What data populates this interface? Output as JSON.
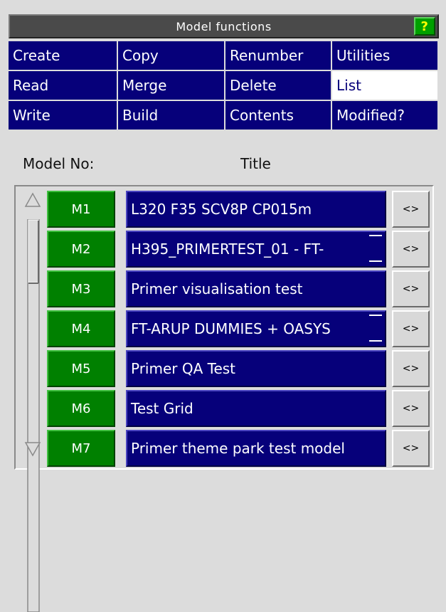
{
  "panel": {
    "title": "Model functions",
    "help_label": "?"
  },
  "menu": [
    [
      "Create",
      "Copy",
      "Renumber",
      "Utilities"
    ],
    [
      "Read",
      "Merge",
      "Delete",
      "List"
    ],
    [
      "Write",
      "Build",
      "Contents",
      "Modified?"
    ]
  ],
  "menu_selected": "List",
  "headers": {
    "model_no": "Model No:",
    "title": "Title"
  },
  "models": [
    {
      "id": "M1",
      "title": "L320 F35 SCV8P CP015m",
      "truncated": false
    },
    {
      "id": "M2",
      "title": "H395_PRIMERTEST_01 - FT-",
      "truncated": true
    },
    {
      "id": "M3",
      "title": "Primer visualisation test",
      "truncated": false
    },
    {
      "id": "M4",
      "title": "FT-ARUP DUMMIES + OASYS",
      "truncated": true
    },
    {
      "id": "M5",
      "title": "Primer QA Test",
      "truncated": false
    },
    {
      "id": "M6",
      "title": "Test Grid",
      "truncated": false
    },
    {
      "id": "M7",
      "title": "Primer theme park test model",
      "truncated": false
    }
  ],
  "row_button_label": "<>",
  "colors": {
    "panel_blue": "#06007a",
    "model_green": "#008000",
    "help_green": "#00a000",
    "help_text": "#ffff00",
    "background": "#dcdcdc"
  }
}
